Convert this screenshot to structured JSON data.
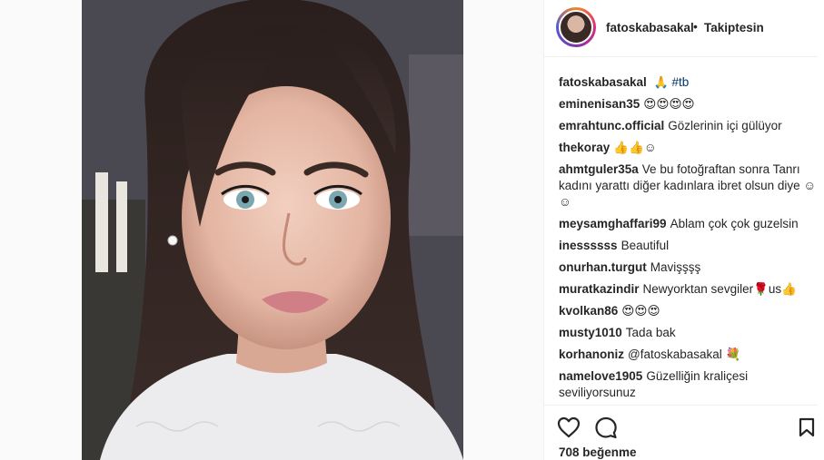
{
  "post": {
    "username": "fatoskabasakal",
    "separator": "•",
    "follow_status": "Takiptesin",
    "caption": {
      "user": "fatoskabasakal",
      "emoji": "🙏",
      "hashtag": "#tb"
    },
    "likes": "708 beğenme"
  },
  "comments": [
    {
      "user": "eminenisan35",
      "text": "😍😍😍😍"
    },
    {
      "user": "emrahtunc.official",
      "text": "Gözlerinin içi gülüyor"
    },
    {
      "user": "thekoray",
      "text": "👍👍☺"
    },
    {
      "user": "ahmtguler35a",
      "text": "Ve bu fotoğraftan sonra Tanrı kadını yarattı diğer kadınlara ibret olsun diye ☺☺"
    },
    {
      "user": "meysamghaffari99",
      "text": "Ablam çok çok guzelsin"
    },
    {
      "user": "inessssss",
      "text": "Beautiful"
    },
    {
      "user": "onurhan.turgut",
      "text": "Mavişşşş"
    },
    {
      "user": "muratkazindir",
      "text": "Newyorktan sevgiler🌹us👍"
    },
    {
      "user": "kvolkan86",
      "text": "😍😍😍"
    },
    {
      "user": "musty1010",
      "text": "Tada bak"
    },
    {
      "user": "korhanoniz",
      "text": "@fatoskabasakal 💐"
    },
    {
      "user": "namelove1905",
      "text": "Güzelliğin kraliçesi seviliyorsunuz"
    }
  ],
  "icons": {
    "like": "heart-icon",
    "comment": "comment-icon",
    "save": "bookmark-icon"
  },
  "colors": {
    "hashtag": "#003569",
    "text": "#262626",
    "divider": "#efefef"
  }
}
